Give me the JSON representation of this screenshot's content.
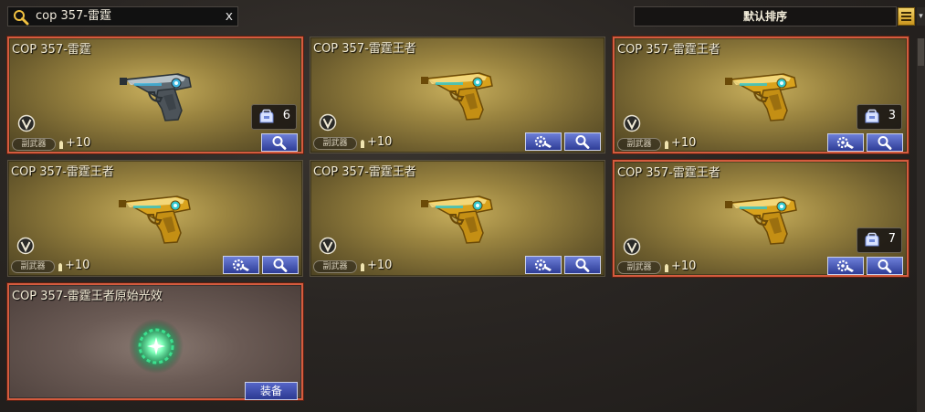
{
  "search": {
    "value": "cop 357-雷霆",
    "clear_label": "x"
  },
  "sort": {
    "label": "默认排序"
  },
  "colors": {
    "card_gold": "#9a8440",
    "selected_border": "#d45b3e",
    "button_blue": "#3a4aa8"
  },
  "cards": [
    {
      "title": "COP 357-雷霆",
      "tag": "副武器",
      "ammo": "+10",
      "skin": "silver",
      "count": "6",
      "selected": true
    },
    {
      "title": "COP 357-雷霆王者",
      "tag": "副武器",
      "ammo": "+10",
      "skin": "gold",
      "selected": false
    },
    {
      "title": "COP 357-雷霆王者",
      "tag": "副武器",
      "ammo": "+10",
      "skin": "gold",
      "count": "3",
      "selected": true
    },
    {
      "title": "COP 357-雷霆王者",
      "tag": "副武器",
      "ammo": "+10",
      "skin": "gold",
      "selected": false
    },
    {
      "title": "COP 357-雷霆王者",
      "tag": "副武器",
      "ammo": "+10",
      "skin": "gold",
      "selected": false
    },
    {
      "title": "COP 357-雷霆王者",
      "tag": "副武器",
      "ammo": "+10",
      "skin": "gold",
      "count": "7",
      "selected": true
    },
    {
      "title": "COP 357-雷霆王者原始光效",
      "skin": "effect",
      "equip_label": "装备",
      "selected": true
    }
  ],
  "icons": [
    "search-icon",
    "clear-icon",
    "menu-icon",
    "vip-badge-icon",
    "ammo-icon",
    "bag-icon",
    "wrench-gear-icon",
    "magnifier-icon",
    "pistol-icon",
    "glow-orb-icon"
  ]
}
